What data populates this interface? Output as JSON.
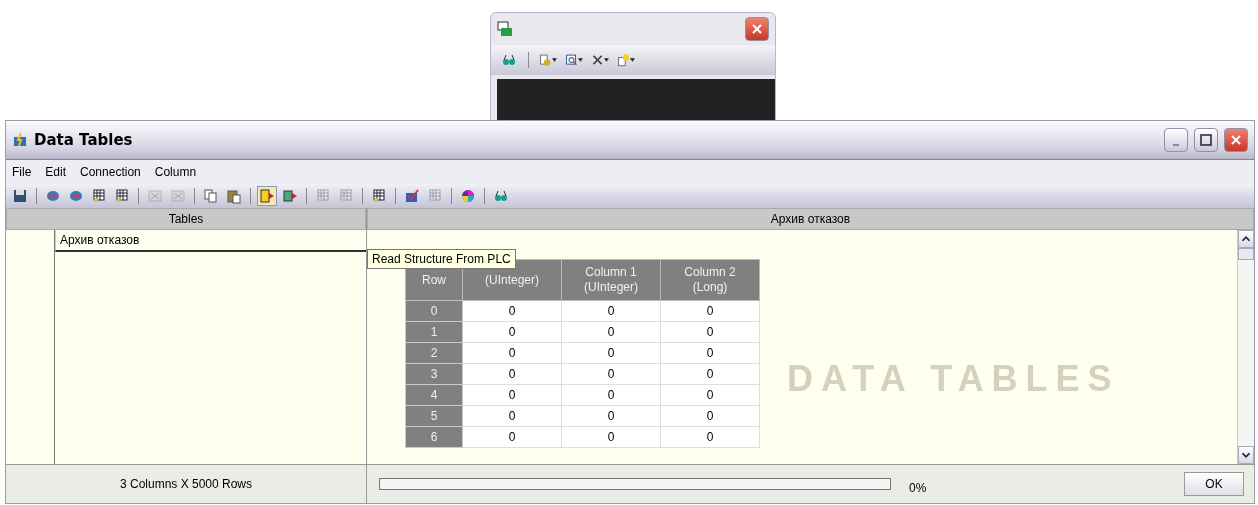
{
  "back_window": {
    "toolbar": [
      {
        "kind": "button",
        "dropdown": false
      },
      {
        "kind": "separator"
      },
      {
        "kind": "button",
        "dropdown": true
      },
      {
        "kind": "button",
        "dropdown": true
      },
      {
        "kind": "button",
        "dropdown": true
      },
      {
        "kind": "button",
        "dropdown": true
      }
    ]
  },
  "window": {
    "title": "Data Tables"
  },
  "menu": [
    "File",
    "Edit",
    "Connection",
    "Column"
  ],
  "toolbar": [
    {
      "kind": "button",
      "disabled": false,
      "selected": false
    },
    {
      "kind": "separator"
    },
    {
      "kind": "button",
      "disabled": false,
      "selected": false
    },
    {
      "kind": "button",
      "disabled": false,
      "selected": false
    },
    {
      "kind": "button",
      "disabled": false,
      "selected": false
    },
    {
      "kind": "button",
      "disabled": false,
      "selected": false
    },
    {
      "kind": "separator"
    },
    {
      "kind": "button",
      "disabled": true,
      "selected": false
    },
    {
      "kind": "button",
      "disabled": true,
      "selected": false
    },
    {
      "kind": "separator"
    },
    {
      "kind": "button",
      "disabled": false,
      "selected": false
    },
    {
      "kind": "button",
      "disabled": false,
      "selected": false
    },
    {
      "kind": "separator"
    },
    {
      "kind": "button",
      "disabled": false,
      "selected": true
    },
    {
      "kind": "button",
      "disabled": false,
      "selected": false
    },
    {
      "kind": "separator"
    },
    {
      "kind": "button",
      "disabled": true,
      "selected": false
    },
    {
      "kind": "button",
      "disabled": true,
      "selected": false
    },
    {
      "kind": "separator"
    },
    {
      "kind": "button",
      "disabled": false,
      "selected": false
    },
    {
      "kind": "separator"
    },
    {
      "kind": "button",
      "disabled": false,
      "selected": false
    },
    {
      "kind": "button",
      "disabled": true,
      "selected": false
    },
    {
      "kind": "separator"
    },
    {
      "kind": "button",
      "disabled": false,
      "selected": false
    },
    {
      "kind": "separator"
    },
    {
      "kind": "button",
      "disabled": false,
      "selected": false
    }
  ],
  "tooltip": "Read Structure From PLC",
  "tables_panel": {
    "header": "Tables",
    "items": [
      {
        "label": "Архив отказов",
        "selected": true
      }
    ]
  },
  "table_panel": {
    "header": "Архив отказов",
    "watermark": "DATA TABLES",
    "columns": [
      {
        "name": "Row"
      },
      {
        "type": "(UInteger)"
      },
      {
        "name": "Column 1",
        "type": "(UInteger)"
      },
      {
        "name": "Column 2",
        "type": "(Long)"
      }
    ],
    "rows": [
      [
        "0",
        "0",
        "0",
        "0"
      ],
      [
        "1",
        "0",
        "0",
        "0"
      ],
      [
        "2",
        "0",
        "0",
        "0"
      ],
      [
        "3",
        "0",
        "0",
        "0"
      ],
      [
        "4",
        "0",
        "0",
        "0"
      ],
      [
        "5",
        "0",
        "0",
        "0"
      ],
      [
        "6",
        "0",
        "0",
        "0"
      ]
    ]
  },
  "status_bar": {
    "summary": "3 Columns X 5000 Rows",
    "progress": {
      "level": 0
    },
    "percent": "0%",
    "ok_button": "OK"
  }
}
